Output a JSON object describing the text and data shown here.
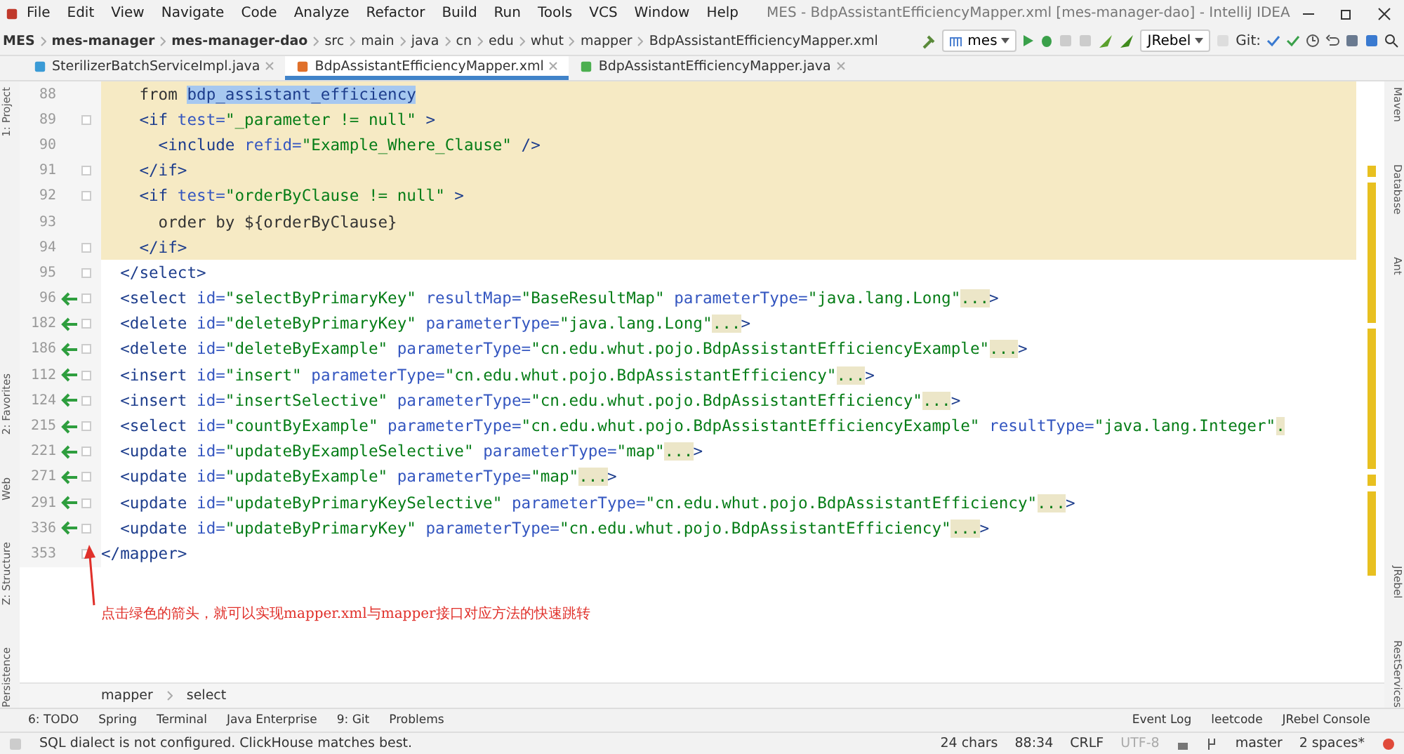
{
  "window": {
    "title": "MES - BdpAssistantEfficiencyMapper.xml [mes-manager-dao] - IntelliJ IDEA",
    "menu": [
      "File",
      "Edit",
      "View",
      "Navigate",
      "Code",
      "Analyze",
      "Refactor",
      "Build",
      "Run",
      "Tools",
      "VCS",
      "Window",
      "Help"
    ]
  },
  "nav_bar": {
    "path": [
      {
        "label": "MES",
        "bold": true
      },
      {
        "label": "mes-manager",
        "bold": true
      },
      {
        "label": "mes-manager-dao",
        "bold": true
      },
      {
        "label": "src",
        "bold": false
      },
      {
        "label": "main",
        "bold": false
      },
      {
        "label": "java",
        "bold": false
      },
      {
        "label": "cn",
        "bold": false
      },
      {
        "label": "edu",
        "bold": false
      },
      {
        "label": "whut",
        "bold": false
      },
      {
        "label": "mapper",
        "bold": false
      },
      {
        "label": "BdpAssistantEfficiencyMapper.xml",
        "bold": false
      }
    ],
    "run_config": "mes",
    "jrebel": "JRebel",
    "git_label": "Git:"
  },
  "tabs": [
    {
      "label": "SterilizerBatchServiceImpl.java",
      "kind": "class",
      "selected": false
    },
    {
      "label": "BdpAssistantEfficiencyMapper.xml",
      "kind": "xml",
      "selected": true
    },
    {
      "label": "BdpAssistantEfficiencyMapper.java",
      "kind": "interface",
      "selected": false
    }
  ],
  "left_tool_strip": [
    "1: Project",
    "2: Favorites",
    "Web",
    "Z: Structure",
    "Persistence"
  ],
  "right_tool_strip": [
    "Maven",
    "Database",
    "Ant",
    "JRebel",
    "RestServices"
  ],
  "editor": {
    "lines": [
      {
        "number": "88",
        "highlighted": true,
        "gutter_arrow": false,
        "fold_marker": false,
        "segments": [
          {
            "kind": "text",
            "text": "    from "
          },
          {
            "kind": "selection",
            "text": "bdp_assistant_efficiency"
          }
        ]
      },
      {
        "number": "89",
        "highlighted": true,
        "gutter_arrow": false,
        "fold_marker": true,
        "segments": [
          {
            "kind": "tag",
            "text": "    <if "
          },
          {
            "kind": "attr",
            "text": "test="
          },
          {
            "kind": "value",
            "text": "\"_parameter != null\""
          },
          {
            "kind": "tag",
            "text": " >"
          }
        ]
      },
      {
        "number": "90",
        "highlighted": true,
        "gutter_arrow": false,
        "fold_marker": false,
        "segments": [
          {
            "kind": "tag",
            "text": "      <include "
          },
          {
            "kind": "attr",
            "text": "refid="
          },
          {
            "kind": "value",
            "text": "\"Example_Where_Clause\""
          },
          {
            "kind": "tag",
            "text": " />"
          }
        ]
      },
      {
        "number": "91",
        "highlighted": true,
        "gutter_arrow": false,
        "fold_marker": true,
        "segments": [
          {
            "kind": "tag",
            "text": "    </if>"
          }
        ]
      },
      {
        "number": "92",
        "highlighted": true,
        "gutter_arrow": false,
        "fold_marker": true,
        "segments": [
          {
            "kind": "tag",
            "text": "    <if "
          },
          {
            "kind": "attr",
            "text": "test="
          },
          {
            "kind": "value",
            "text": "\"orderByClause != null\""
          },
          {
            "kind": "tag",
            "text": " >"
          }
        ]
      },
      {
        "number": "93",
        "highlighted": true,
        "gutter_arrow": false,
        "fold_marker": false,
        "segments": [
          {
            "kind": "text",
            "text": "      order by ${orderByClause}"
          }
        ]
      },
      {
        "number": "94",
        "highlighted": true,
        "gutter_arrow": false,
        "fold_marker": true,
        "segments": [
          {
            "kind": "tag",
            "text": "    </if>"
          }
        ]
      },
      {
        "number": "95",
        "highlighted": false,
        "gutter_arrow": false,
        "fold_marker": true,
        "segments": [
          {
            "kind": "tag",
            "text": "  </select>"
          }
        ]
      },
      {
        "number": "96",
        "highlighted": false,
        "gutter_arrow": true,
        "fold_marker": true,
        "segments": [
          {
            "kind": "tag",
            "text": "  <select "
          },
          {
            "kind": "attr",
            "text": "id="
          },
          {
            "kind": "value",
            "text": "\"selectByPrimaryKey\" "
          },
          {
            "kind": "attr",
            "text": "resultMap="
          },
          {
            "kind": "value",
            "text": "\"BaseResultMap\" "
          },
          {
            "kind": "attr",
            "text": "parameterType="
          },
          {
            "kind": "value",
            "text": "\"java.lang.Long\""
          },
          {
            "kind": "fold",
            "text": "..."
          },
          {
            "kind": "tag",
            "text": ">"
          }
        ]
      },
      {
        "number": "182",
        "highlighted": false,
        "gutter_arrow": true,
        "fold_marker": true,
        "segments": [
          {
            "kind": "tag",
            "text": "  <delete "
          },
          {
            "kind": "attr",
            "text": "id="
          },
          {
            "kind": "value",
            "text": "\"deleteByPrimaryKey\" "
          },
          {
            "kind": "attr",
            "text": "parameterType="
          },
          {
            "kind": "value",
            "text": "\"java.lang.Long\""
          },
          {
            "kind": "fold",
            "text": "..."
          },
          {
            "kind": "tag",
            "text": ">"
          }
        ]
      },
      {
        "number": "186",
        "highlighted": false,
        "gutter_arrow": true,
        "fold_marker": true,
        "segments": [
          {
            "kind": "tag",
            "text": "  <delete "
          },
          {
            "kind": "attr",
            "text": "id="
          },
          {
            "kind": "value",
            "text": "\"deleteByExample\" "
          },
          {
            "kind": "attr",
            "text": "parameterType="
          },
          {
            "kind": "value",
            "text": "\"cn.edu.whut.pojo.BdpAssistantEfficiencyExample\""
          },
          {
            "kind": "fold",
            "text": "..."
          },
          {
            "kind": "tag",
            "text": ">"
          }
        ]
      },
      {
        "number": "112",
        "highlighted": false,
        "gutter_arrow": true,
        "fold_marker": true,
        "segments": [
          {
            "kind": "tag",
            "text": "  <insert "
          },
          {
            "kind": "attr",
            "text": "id="
          },
          {
            "kind": "value",
            "text": "\"insert\" "
          },
          {
            "kind": "attr",
            "text": "parameterType="
          },
          {
            "kind": "value",
            "text": "\"cn.edu.whut.pojo.BdpAssistantEfficiency\""
          },
          {
            "kind": "fold",
            "text": "..."
          },
          {
            "kind": "tag",
            "text": ">"
          }
        ]
      },
      {
        "number": "124",
        "highlighted": false,
        "gutter_arrow": true,
        "fold_marker": true,
        "segments": [
          {
            "kind": "tag",
            "text": "  <insert "
          },
          {
            "kind": "attr",
            "text": "id="
          },
          {
            "kind": "value",
            "text": "\"insertSelective\" "
          },
          {
            "kind": "attr",
            "text": "parameterType="
          },
          {
            "kind": "value",
            "text": "\"cn.edu.whut.pojo.BdpAssistantEfficiency\""
          },
          {
            "kind": "fold",
            "text": "..."
          },
          {
            "kind": "tag",
            "text": ">"
          }
        ]
      },
      {
        "number": "215",
        "highlighted": false,
        "gutter_arrow": true,
        "fold_marker": true,
        "segments": [
          {
            "kind": "tag",
            "text": "  <select "
          },
          {
            "kind": "attr",
            "text": "id="
          },
          {
            "kind": "value",
            "text": "\"countByExample\" "
          },
          {
            "kind": "attr",
            "text": "parameterType="
          },
          {
            "kind": "value",
            "text": "\"cn.edu.whut.pojo.BdpAssistantEfficiencyExample\" "
          },
          {
            "kind": "attr",
            "text": "resultType="
          },
          {
            "kind": "value",
            "text": "\"java.lang.Integer\""
          },
          {
            "kind": "fold",
            "text": "."
          }
        ]
      },
      {
        "number": "221",
        "highlighted": false,
        "gutter_arrow": true,
        "fold_marker": true,
        "segments": [
          {
            "kind": "tag",
            "text": "  <update "
          },
          {
            "kind": "attr",
            "text": "id="
          },
          {
            "kind": "value",
            "text": "\"updateByExampleSelective\" "
          },
          {
            "kind": "attr",
            "text": "parameterType="
          },
          {
            "kind": "value",
            "text": "\"map\""
          },
          {
            "kind": "fold",
            "text": "..."
          },
          {
            "kind": "tag",
            "text": ">"
          }
        ]
      },
      {
        "number": "271",
        "highlighted": false,
        "gutter_arrow": true,
        "fold_marker": true,
        "segments": [
          {
            "kind": "tag",
            "text": "  <update "
          },
          {
            "kind": "attr",
            "text": "id="
          },
          {
            "kind": "value",
            "text": "\"updateByExample\" "
          },
          {
            "kind": "attr",
            "text": "parameterType="
          },
          {
            "kind": "value",
            "text": "\"map\""
          },
          {
            "kind": "fold",
            "text": "..."
          },
          {
            "kind": "tag",
            "text": ">"
          }
        ]
      },
      {
        "number": "291",
        "highlighted": false,
        "gutter_arrow": true,
        "fold_marker": true,
        "segments": [
          {
            "kind": "tag",
            "text": "  <update "
          },
          {
            "kind": "attr",
            "text": "id="
          },
          {
            "kind": "value",
            "text": "\"updateByPrimaryKeySelective\" "
          },
          {
            "kind": "attr",
            "text": "parameterType="
          },
          {
            "kind": "value",
            "text": "\"cn.edu.whut.pojo.BdpAssistantEfficiency\""
          },
          {
            "kind": "fold",
            "text": "..."
          },
          {
            "kind": "tag",
            "text": ">"
          }
        ]
      },
      {
        "number": "336",
        "highlighted": false,
        "gutter_arrow": true,
        "fold_marker": true,
        "segments": [
          {
            "kind": "tag",
            "text": "  <update "
          },
          {
            "kind": "attr",
            "text": "id="
          },
          {
            "kind": "value",
            "text": "\"updateByPrimaryKey\" "
          },
          {
            "kind": "attr",
            "text": "parameterType="
          },
          {
            "kind": "value",
            "text": "\"cn.edu.whut.pojo.BdpAssistantEfficiency\""
          },
          {
            "kind": "fold",
            "text": "..."
          },
          {
            "kind": "tag",
            "text": ">"
          }
        ]
      },
      {
        "number": "353",
        "highlighted": false,
        "gutter_arrow": false,
        "fold_marker": true,
        "segments": [
          {
            "kind": "tag",
            "text": "</mapper>"
          }
        ]
      }
    ],
    "annotation": "点击绿色的箭头，就可以实现mapper.xml与mapper接口对应方法的快速跳转"
  },
  "breadcrumbs": [
    "mapper",
    "select"
  ],
  "tool_tabs_left": [
    "6: TODO",
    "Spring",
    "Terminal",
    "Java Enterprise",
    "9: Git",
    "Problems"
  ],
  "tool_tabs_right": [
    "Event Log",
    "leetcode",
    "JRebel Console"
  ],
  "status_bar": {
    "message": "SQL dialect is not configured. ClickHouse matches best.",
    "items": [
      "24 chars",
      "88:34",
      "CRLF",
      "UTF-8"
    ],
    "branch": "master",
    "indent": "2 spaces*"
  }
}
